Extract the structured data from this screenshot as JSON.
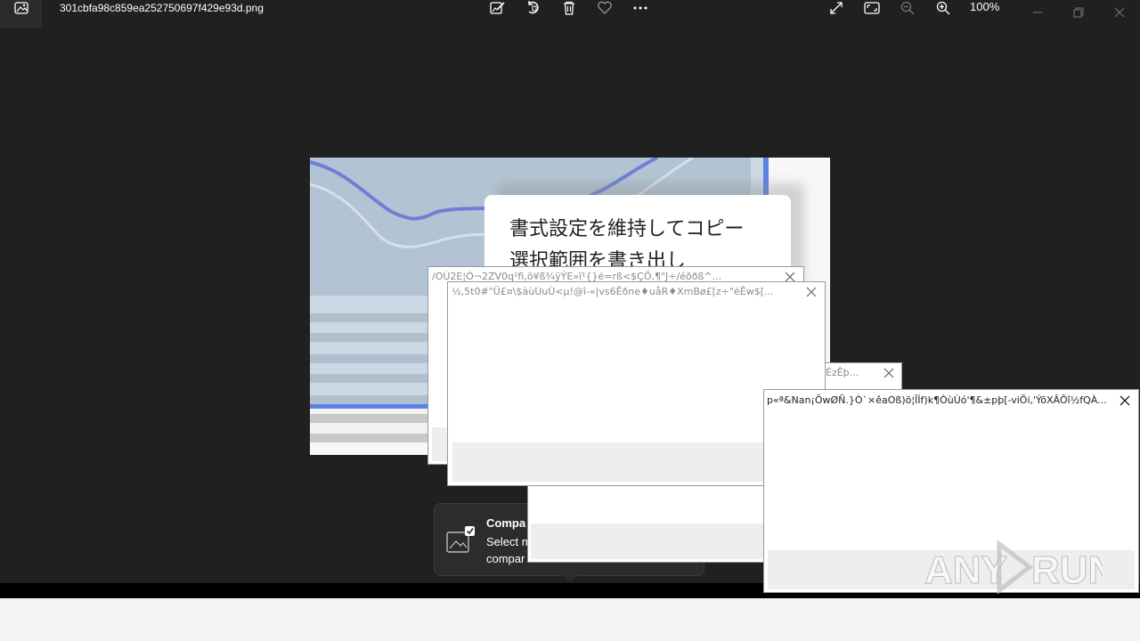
{
  "window": {
    "filename": "301cbfa98c859ea252750697f429e93d.png",
    "zoom": "100%"
  },
  "toolbar": {
    "icons": [
      "edit-icon",
      "rotate-icon",
      "delete-icon",
      "favorite-icon",
      "more-icon"
    ],
    "right_icons": [
      "fullscreen-icon",
      "fit-icon",
      "zoom-out-icon",
      "zoom-in-icon"
    ]
  },
  "preview": {
    "line1": "書式設定を維持してコピー",
    "line2": "選択範囲を書き出し"
  },
  "dialogs": [
    {
      "title": "/OÙ2E¦Ò¬2ZV0q²fì,ö¥ß¾ÿÝE»ï¹{}é=rß<$ÇÖ,¶\"J÷/é­õðß^..."
    },
    {
      "title": "½,5t0#\"Ü£¤\\$àùÙuÙ<µ!@î-«|vs6Êðne♦uåR♦XmBø£[z÷\"ëÊw$[..."
    },
    {
      "title": "ÉzÊþ..."
    },
    {
      "title": "p«ª&Nan¡ÕwØÑ.}Ò`×êaOß)ö¦ÎÍf)k¶ÒùÙó'¶&±pþ[-viÕi,'ÝõXÂÕî½fQÀ..."
    }
  ],
  "compare": {
    "title": "Compa",
    "line1": "Select m",
    "line2": "compar"
  },
  "watermark": "ANY RUN",
  "colors": {
    "viewer_bg": "#202020",
    "accent": "#5b82e6",
    "preview_blue": "#b2c4d3",
    "curve": "#6f7fd6"
  }
}
